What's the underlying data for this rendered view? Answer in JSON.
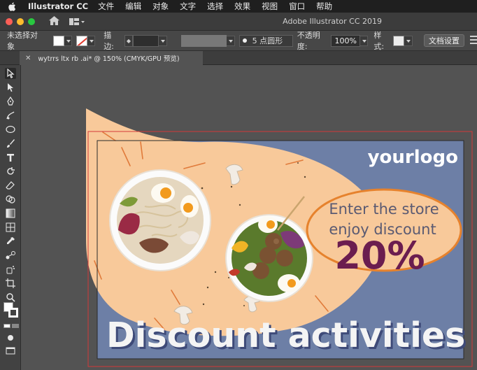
{
  "menubar": {
    "app_name": "Illustrator CC",
    "items": [
      "文件",
      "编辑",
      "对象",
      "文字",
      "选择",
      "效果",
      "视图",
      "窗口",
      "帮助"
    ]
  },
  "titlebar": {
    "window_title": "Adobe Illustrator CC 2019"
  },
  "controlbar": {
    "selection_label": "未选择对象",
    "stroke_label": "描边:",
    "brush_label": "5 点圆形",
    "opacity_label": "不透明度:",
    "opacity_value": "100%",
    "style_label": "样式:",
    "doc_setup_button": "文档设置"
  },
  "document_tab": {
    "title": "wytrrs ltx rb .ai* @ 150% (CMYK/GPU 预览)"
  },
  "artwork": {
    "logo_text": "yourlogo",
    "promo_line1": "Enter the store",
    "promo_line2": "enjoy discount",
    "promo_percent": "20%",
    "headline": "Discount activities"
  },
  "colors": {
    "banner_blue": "#6d7fa6",
    "peach": "#f8c99a",
    "orange_outline": "#e6822d",
    "percent_purple": "#6b1d4f",
    "headline_white": "#f4f4f4",
    "selection_red": "#d33a3a"
  }
}
